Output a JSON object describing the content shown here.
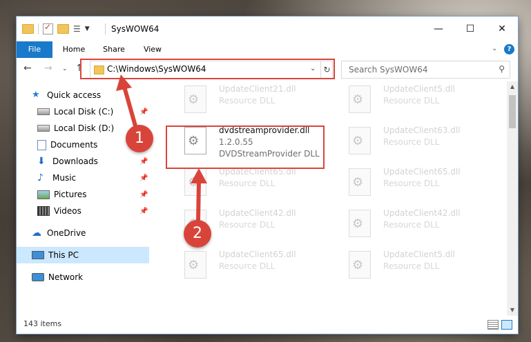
{
  "window": {
    "title": "SysWOW64"
  },
  "controls": {
    "minimize": "—",
    "maximize": "☐",
    "close": "✕"
  },
  "ribbon": {
    "tabs": [
      "File",
      "Home",
      "Share",
      "View"
    ],
    "help": "?"
  },
  "address": {
    "path": "C:\\Windows\\SysWOW64"
  },
  "search": {
    "placeholder": "Search SysWOW64"
  },
  "sidebar": {
    "items": [
      {
        "label": "Quick access",
        "icon": "star-icon"
      },
      {
        "label": "Local Disk (C:)",
        "icon": "drive-icon",
        "pinned": true
      },
      {
        "label": "Local Disk (D:)",
        "icon": "drive-icon",
        "pinned": false
      },
      {
        "label": "Documents",
        "icon": "documents-icon",
        "pinned": true
      },
      {
        "label": "Downloads",
        "icon": "download-icon",
        "pinned": true
      },
      {
        "label": "Music",
        "icon": "music-icon",
        "pinned": true
      },
      {
        "label": "Pictures",
        "icon": "pictures-icon",
        "pinned": true
      },
      {
        "label": "Videos",
        "icon": "videos-icon",
        "pinned": true
      },
      {
        "label": "OneDrive",
        "icon": "cloud-icon"
      },
      {
        "label": "This PC",
        "icon": "computer-icon",
        "selected": true
      },
      {
        "label": "Network",
        "icon": "network-icon"
      }
    ]
  },
  "files": [
    {
      "name": "UpdateClient21.dll",
      "type": "Resource DLL"
    },
    {
      "name": "UpdateClient5.dll",
      "type": "Resource DLL"
    },
    {
      "name": "dvdstreamprovider.dll",
      "version": "1.2.0.55",
      "type": "DVDStreamProvider DLL",
      "highlighted": true
    },
    {
      "name": "UpdateClient63.dll",
      "type": "Resource DLL"
    },
    {
      "name": "UpdateClient65.dll",
      "type": "Resource DLL"
    },
    {
      "name": "UpdateClient65.dll",
      "type": "Resource DLL"
    },
    {
      "name": "UpdateClient42.dll",
      "type": "Resource DLL"
    },
    {
      "name": "UpdateClient42.dll",
      "type": "Resource DLL"
    },
    {
      "name": "UpdateClient65.dll",
      "type": "Resource DLL"
    },
    {
      "name": "UpdateClient5.dll",
      "type": "Resource DLL"
    }
  ],
  "status": {
    "count": "143 items"
  },
  "annotations": {
    "step1": "1",
    "step2": "2",
    "color": "#d9443a"
  }
}
